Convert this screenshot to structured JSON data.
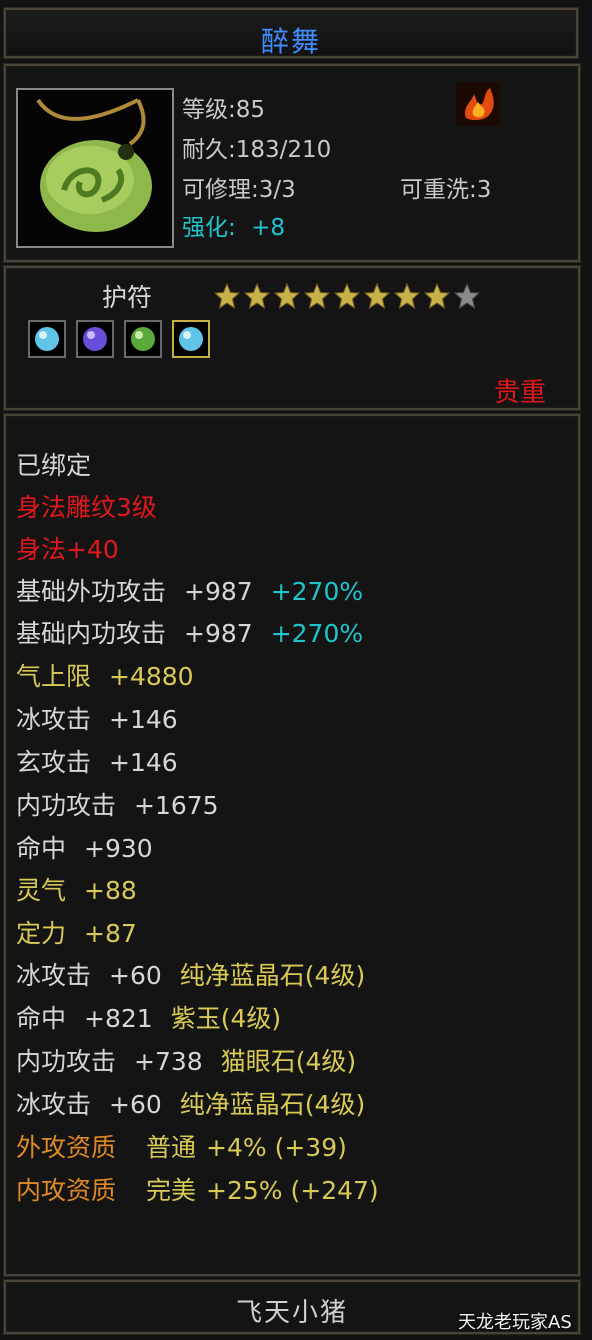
{
  "item": {
    "name": "醉舞",
    "level": "等级:85",
    "durability": "耐久:183/210",
    "repairable": "可修理:3/3",
    "rewashable": "可重洗:3",
    "enhance_label": "强化:",
    "enhance_value": "+8",
    "icon": "jade-pendant-icon",
    "element_icon": "fire-icon"
  },
  "type": {
    "label": "护符",
    "stars_filled": 8,
    "stars_total": 9,
    "grade": "贵重",
    "gems": [
      "blue-gem-icon",
      "purple-gem-icon",
      "green-gem-icon",
      "blue-gem-icon"
    ]
  },
  "attributes": {
    "bound": "已绑定",
    "engrave": "身法雕纹3级",
    "agility": "身法+40",
    "ext_attack": {
      "label": "基础外功攻击",
      "value": "+987",
      "pct": "+270%"
    },
    "int_attack": {
      "label": "基础内功攻击",
      "value": "+987",
      "pct": "+270%"
    },
    "qi": {
      "label": "气上限",
      "value": "+4880"
    },
    "ice": {
      "label": "冰攻击",
      "value": "+146"
    },
    "xuan": {
      "label": "玄攻击",
      "value": "+146"
    },
    "inner": {
      "label": "内功攻击",
      "value": "+1675"
    },
    "hit": {
      "label": "命中",
      "value": "+930"
    },
    "spirit": {
      "label": "灵气",
      "value": "+88"
    },
    "focus": {
      "label": "定力",
      "value": "+87"
    },
    "gem1": {
      "label": "冰攻击",
      "value": "+60",
      "gem": "纯净蓝晶石(4级)"
    },
    "gem2": {
      "label": "命中",
      "value": "+821",
      "gem": "紫玉(4级)"
    },
    "gem3": {
      "label": "内功攻击",
      "value": "+738",
      "gem": "猫眼石(4级)"
    },
    "gem4": {
      "label": "冰攻击",
      "value": "+60",
      "gem": "纯净蓝晶石(4级)"
    },
    "q1": {
      "label": "外攻资质",
      "grade": "普通",
      "value": "+4% (+39)"
    },
    "q2": {
      "label": "内攻资质",
      "grade": "完美",
      "value": "+25% (+247)"
    }
  },
  "owner": "飞天小猪",
  "watermark": "天龙老玩家AS",
  "colors": {
    "title": "#3f8cff",
    "red": "#e0181c",
    "cyan": "#20c4cc",
    "yellow": "#d8ca55",
    "orange": "#e08a26"
  }
}
